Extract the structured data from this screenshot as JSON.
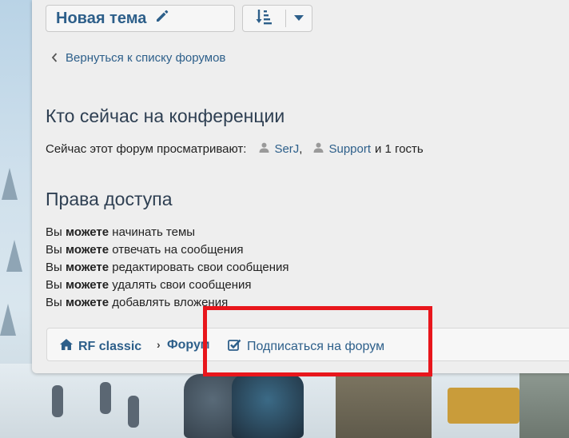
{
  "toolbar": {
    "new_topic_label": "Новая тема",
    "new_topic_icon": "pencil-icon",
    "sort_icon": "sort-amount-icon",
    "dropdown_icon": "caret-down-icon"
  },
  "back_link": {
    "label": "Вернуться к списку форумов",
    "icon": "chevron-left-icon"
  },
  "who_online": {
    "title": "Кто сейчас на конференции",
    "prefix": "Сейчас этот форум просматривают:",
    "users": [
      {
        "name": "SerJ",
        "icon": "user-icon",
        "suffix": ","
      },
      {
        "name": "Support",
        "icon": "user-icon",
        "suffix": ""
      }
    ],
    "guests_text": "и 1 гость"
  },
  "permissions": {
    "title": "Права доступа",
    "items": [
      {
        "prefix": "Вы",
        "strong": "можете",
        "rest": "начинать темы"
      },
      {
        "prefix": "Вы",
        "strong": "можете",
        "rest": "отвечать на сообщения"
      },
      {
        "prefix": "Вы",
        "strong": "можете",
        "rest": "редактировать свои сообщения"
      },
      {
        "prefix": "Вы",
        "strong": "можете",
        "rest": "удалять свои сообщения"
      },
      {
        "prefix": "Вы",
        "strong": "можете",
        "rest": "добавлять вложения"
      }
    ]
  },
  "breadcrumb": {
    "home_label": "RF classic",
    "home_icon": "home-icon",
    "separator": "›",
    "forum_label": "Форум",
    "subscribe_label": "Подписаться на форум",
    "subscribe_icon": "checkbox-checked-icon"
  },
  "colors": {
    "link": "#2d5f8a",
    "highlight": "#e8161c",
    "panel_bg": "#eeeeee"
  }
}
